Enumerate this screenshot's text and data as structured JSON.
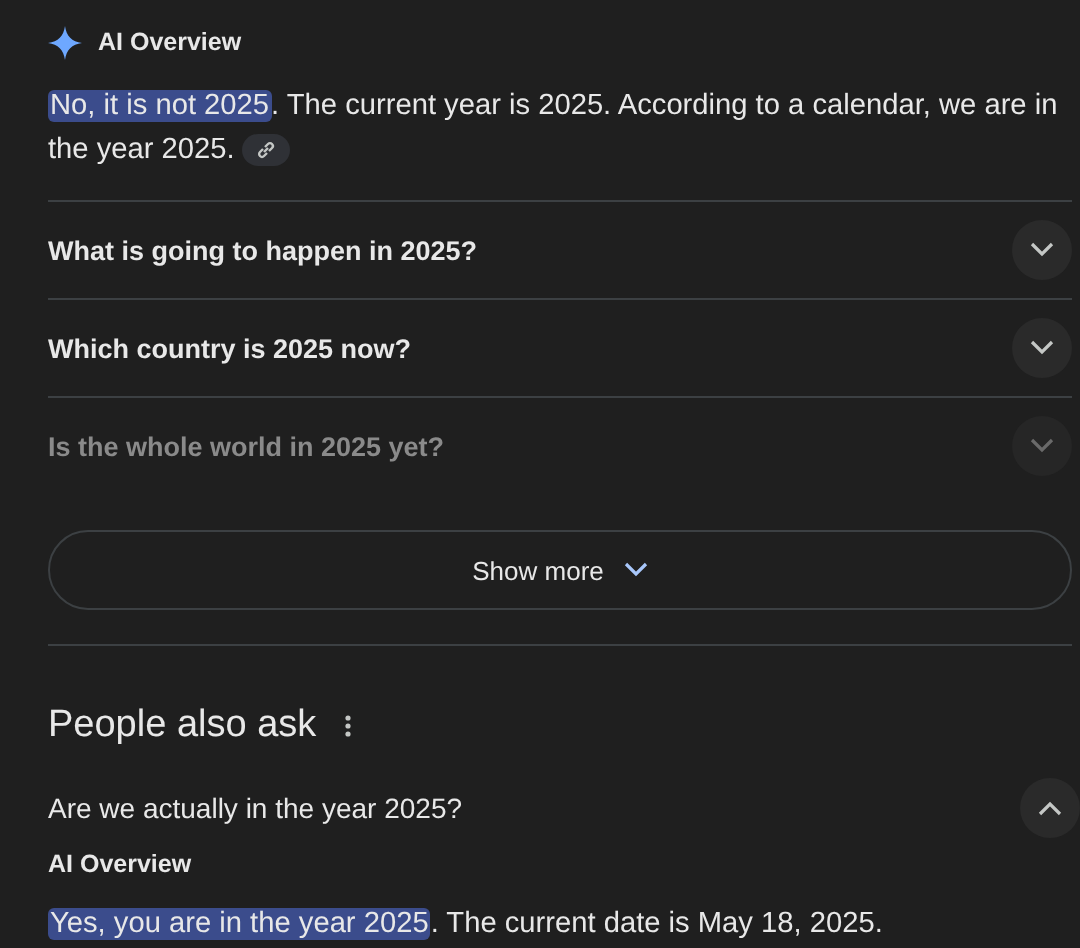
{
  "overview": {
    "label": "AI Overview",
    "answer": {
      "highlighted": "No, it is not 2025",
      "text": ". The current year is 2025. According to a calendar, we are in the year 2025."
    }
  },
  "questions": [
    {
      "text": "What is going to happen in 2025?",
      "expanded": false,
      "faded": false
    },
    {
      "text": "Which country is 2025 now?",
      "expanded": false,
      "faded": false
    },
    {
      "text": "Is the whole world in 2025 yet?",
      "expanded": false,
      "faded": true
    }
  ],
  "show_more": {
    "label": "Show more"
  },
  "people_also_ask": {
    "title": "People also ask",
    "items": [
      {
        "question": "Are we actually in the year 2025?",
        "expanded": true,
        "overview_label": "AI Overview",
        "answer": {
          "highlighted": "Yes, you are in the year 2025",
          "text": ". The current date is May 18, 2025."
        }
      }
    ]
  }
}
